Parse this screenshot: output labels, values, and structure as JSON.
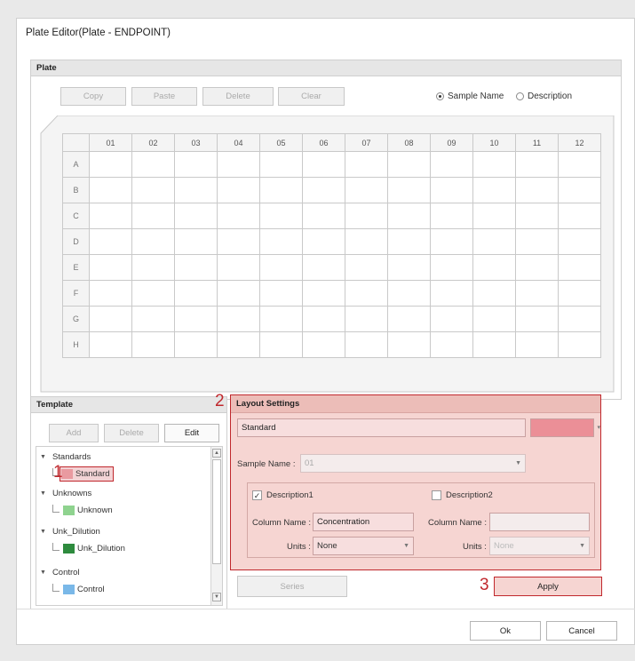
{
  "window": {
    "title": "Plate Editor(Plate - ENDPOINT)"
  },
  "plate": {
    "header": "Plate",
    "toolbar": {
      "copy": "Copy",
      "paste": "Paste",
      "delete": "Delete",
      "clear": "Clear"
    },
    "radio": {
      "sample_name": "Sample Name",
      "description": "Description",
      "selected": "Sample Name"
    },
    "columns": [
      "01",
      "02",
      "03",
      "04",
      "05",
      "06",
      "07",
      "08",
      "09",
      "10",
      "11",
      "12"
    ],
    "rows": [
      "A",
      "B",
      "C",
      "D",
      "E",
      "F",
      "G",
      "H"
    ]
  },
  "template": {
    "header": "Template",
    "toolbar": {
      "add": "Add",
      "delete": "Delete",
      "edit": "Edit"
    },
    "groups": [
      {
        "label": "Standards",
        "child": "Standard",
        "color": "#e99aa0"
      },
      {
        "label": "Unknowns",
        "child": "Unknown",
        "color": "#8fd38f"
      },
      {
        "label": "Unk_Dilution",
        "child": "Unk_Dilution",
        "color": "#2e8b3e"
      },
      {
        "label": "Control",
        "child": "Control",
        "color": "#7ab8e8"
      }
    ]
  },
  "layout": {
    "header": "Layout Settings",
    "name_value": "Standard",
    "color_value": "#eb8f97",
    "sample_name_label": "Sample Name :",
    "sample_name_value": "01",
    "desc1_label": "Description1",
    "desc1_checked": true,
    "desc2_label": "Description2",
    "desc2_checked": false,
    "col_name_label": "Column Name :",
    "col_name_value": "Concentration",
    "col_name2_label": "Column Name :",
    "col_name2_value": "",
    "units_label": "Units :",
    "units_value": "None",
    "units2_label": "Units :",
    "units2_value": "None"
  },
  "buttons": {
    "series": "Series",
    "apply": "Apply",
    "ok": "Ok",
    "cancel": "Cancel"
  },
  "callouts": {
    "one": "1",
    "two": "2",
    "three": "3"
  },
  "colors": {
    "accent_red": "#c0282d",
    "highlight_fill": "#f7dede"
  }
}
